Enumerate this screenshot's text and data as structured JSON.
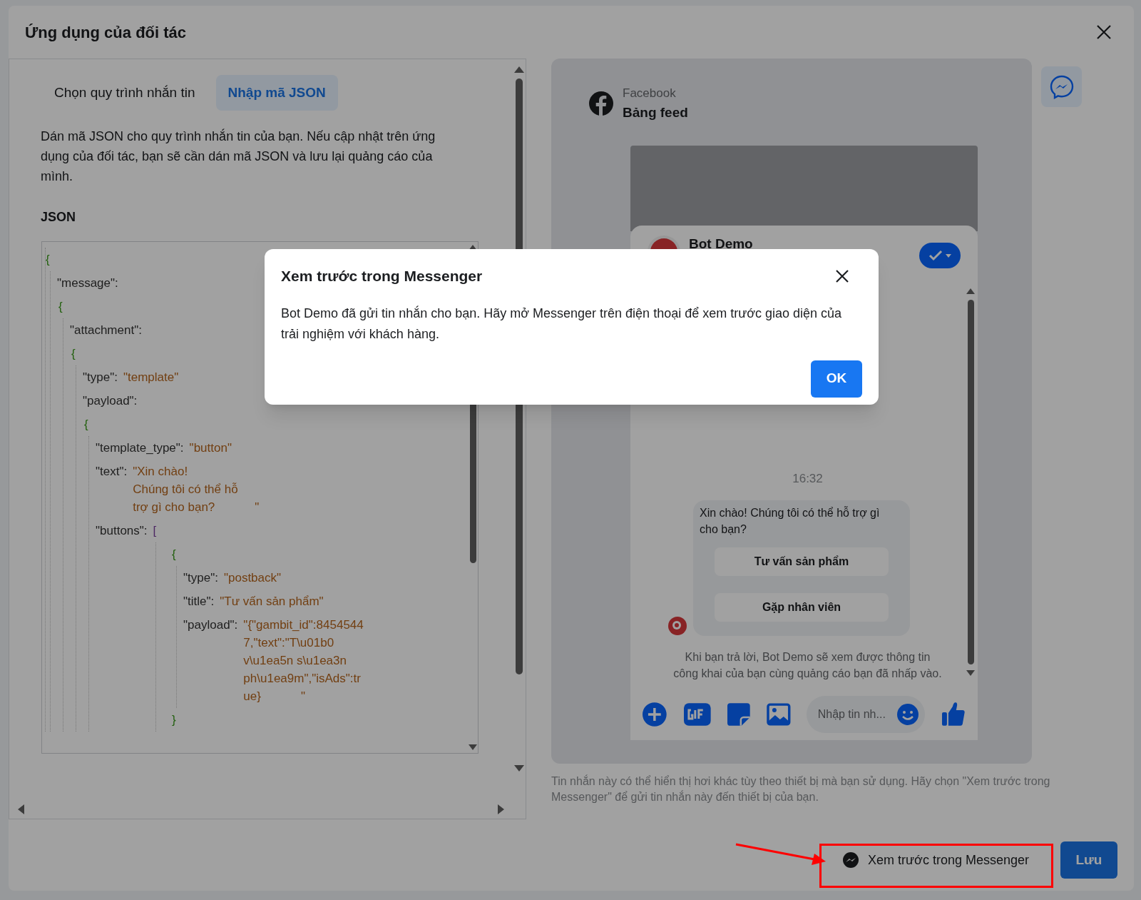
{
  "dialog": {
    "title": "Ứng dụng của đối tác"
  },
  "tabs": [
    {
      "label": "Chọn quy trình nhắn tin",
      "selected": false
    },
    {
      "label": "Nhập mã JSON",
      "selected": true
    }
  ],
  "description": "Dán mã JSON cho quy trình nhắn tin của bạn. Nếu cập nhật trên ứng dụng của đối tác, bạn sẽ cần dán mã JSON và lưu lại quảng cáo của mình.",
  "json_label": "JSON",
  "json_code": {
    "open": "{",
    "members": [
      {
        "kind": "object",
        "key": "\"message\":",
        "value": {
          "open": "{",
          "members": [
            {
              "kind": "object",
              "key": "\"attachment\":",
              "value": {
                "open": "{",
                "members": [
                  {
                    "kind": "string",
                    "key": "\"type\":",
                    "lines": [
                      "\"template\""
                    ]
                  },
                  {
                    "kind": "object",
                    "key": "\"payload\":",
                    "value": {
                      "open": "{",
                      "members": [
                        {
                          "kind": "string",
                          "key": "\"template_type\":",
                          "lines": [
                            "\"button\""
                          ]
                        },
                        {
                          "kind": "string",
                          "key": "\"text\":",
                          "lines": [
                            "\"Xin chào!",
                            "Chúng tôi có thể hỗ",
                            "trợ gì cho bạn?"
                          ],
                          "end": "\""
                        },
                        {
                          "kind": "array",
                          "key": "\"buttons\":",
                          "open": "[",
                          "items": [
                            {
                              "open": "{",
                              "members": [
                                {
                                  "kind": "string",
                                  "key": "\"type\":",
                                  "lines": [
                                    "\"postback\""
                                  ]
                                },
                                {
                                  "kind": "string",
                                  "key": "\"title\":",
                                  "lines": [
                                    "\"Tư vấn sản phẩm\""
                                  ]
                                },
                                {
                                  "kind": "string",
                                  "key": "\"payload\":",
                                  "lines": [
                                    "\"{\"gambit_id\":8454544",
                                    "7,\"text\":\"T\\u01b0",
                                    "v\\u1ea5n s\\u1ea3n",
                                    "ph\\u1ea9m\",\"isAds\":tr",
                                    "ue}"
                                  ],
                                  "end": "\""
                                }
                              ],
                              "close": "}"
                            }
                          ]
                        }
                      ]
                    }
                  }
                ]
              }
            }
          ]
        }
      }
    ]
  },
  "preview": {
    "platform": "Facebook",
    "placement": "Bảng feed",
    "page_name": "Bot Demo",
    "time": "16:32",
    "message": "Xin chào! Chúng tôi có thể hỗ trợ gì cho bạn?",
    "buttons": [
      "Tư vấn sản phẩm",
      "Gặp nhân viên"
    ],
    "notice": "Khi bạn trả lời, Bot Demo sẽ xem được thông tin công khai của bạn cùng quảng cáo bạn đã nhấp vào.",
    "composer_placeholder": "Nhập tin nh..."
  },
  "preview_note": "Tin nhắn này có thể hiển thị hơi khác tùy theo thiết bị mà bạn sử dụng. Hãy chọn \"Xem trước trong Messenger\" để gửi tin nhắn này đến thiết bị của bạn.",
  "footer": {
    "preview_button": "Xem trước trong Messenger",
    "save_button": "Lưu"
  },
  "modal": {
    "title": "Xem trước trong Messenger",
    "body": "Bot Demo đã gửi tin nhắn cho bạn. Hãy mở Messenger trên điện thoại để xem trước giao diện của trải nghiệm với khách hàng.",
    "ok_button": "OK"
  }
}
